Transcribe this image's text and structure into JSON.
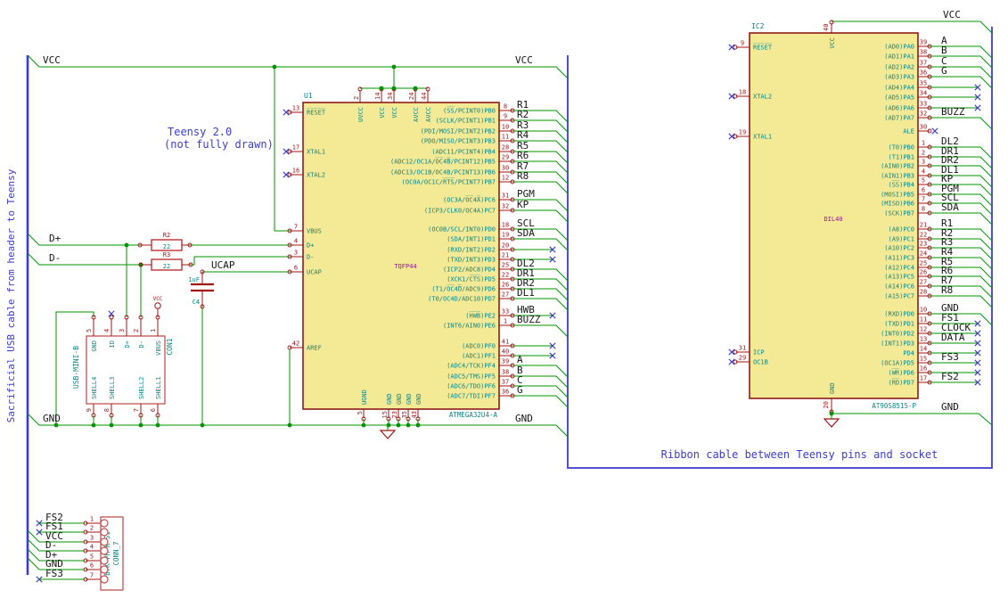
{
  "colors": {
    "wire": "#009400",
    "red": "#A01414",
    "outline": "#8E1A1A",
    "body_fill": "#F4EA96",
    "teal": "#0A8585",
    "magenta": "#8A1A8A",
    "blue": "#3C3CCC",
    "black": "#151515",
    "conn": "#C05050"
  },
  "notes": {
    "left_cable": "Sacrificial USB cable from header to Teensy",
    "teensy_line1": "Teensy 2.0",
    "teensy_line2": "(not fully drawn)",
    "ribbon": "Ribbon cable between Teensy pins and socket"
  },
  "u1": {
    "ref": "U1",
    "part": "ATMEGA32U4-A",
    "footprint": "TQFP44",
    "left_pins": [
      {
        "num": "13",
        "name": "R̅E̅S̅E̅T̅",
        "term": "nc"
      },
      {
        "num": "17",
        "name": "XTAL1",
        "term": "nc"
      },
      {
        "num": "16",
        "name": "XTAL2",
        "term": "nc"
      },
      {
        "num": "7",
        "name": "VBUS",
        "term": "wire"
      },
      {
        "num": "4",
        "name": "D+",
        "term": "wire"
      },
      {
        "num": "3",
        "name": "D-",
        "term": "wire"
      },
      {
        "num": "6",
        "name": "UCAP",
        "term": "wire"
      },
      {
        "num": "42",
        "name": "AREF",
        "term": "wire"
      }
    ],
    "top_pins": [
      {
        "num": "2",
        "name": "UVCC"
      },
      {
        "num": "14",
        "name": "VCC"
      },
      {
        "num": "34",
        "name": "VCC"
      },
      {
        "num": "24",
        "name": "AVCC"
      },
      {
        "num": "44",
        "name": "AVCC"
      }
    ],
    "bottom_pins": [
      {
        "num": "5",
        "name": "UGND"
      },
      {
        "num": "15",
        "name": "GND"
      },
      {
        "num": "23",
        "name": "GND"
      },
      {
        "num": "35",
        "name": "GND"
      },
      {
        "num": "43",
        "name": "GND"
      }
    ],
    "right_pins": [
      {
        "num": "8",
        "name": "(S̅S̅/PCINT0)PB0",
        "label": "R1",
        "term": "bus"
      },
      {
        "num": "9",
        "name": "(SCLK/PCINT1)PB1",
        "label": "R2",
        "term": "bus"
      },
      {
        "num": "10",
        "name": "(PDI/MOSI/PCINT2)PB2",
        "label": "R3",
        "term": "bus"
      },
      {
        "num": "11",
        "name": "(PDO/MISO/PCINT3)PB3",
        "label": "R4",
        "term": "bus"
      },
      {
        "num": "28",
        "name": "(ADC11/PCINT4)PB4",
        "label": "R5",
        "term": "bus"
      },
      {
        "num": "29",
        "name": "(ADC12/OC1A/O̅C̅4̅B̅/PCINT12)PB5",
        "label": "R6",
        "term": "bus"
      },
      {
        "num": "30",
        "name": "(ADC13/OC1B/OC4B/PCINT13)PB6",
        "label": "R7",
        "term": "bus"
      },
      {
        "num": "12",
        "name": "(OC0A/OC1C/R̅T̅S̅/PCINT7)PB7",
        "label": "R8",
        "term": "bus"
      },
      {
        "num": "31",
        "name": "(OC3A/O̅C̅4̅A̅)PC6",
        "label": "PGM",
        "term": "bus"
      },
      {
        "num": "32",
        "name": "(ICP3/CLK0/OC4A)PC7",
        "label": "KP",
        "term": "bus"
      },
      {
        "num": "18",
        "name": "(OC0B/SCL/INT0)PD0",
        "label": "SCL",
        "term": "bus"
      },
      {
        "num": "19",
        "name": "(SDA/INT1)PD1",
        "label": "SDA",
        "term": "bus"
      },
      {
        "num": "20",
        "name": "(RXD/INT2)PD2",
        "label": "",
        "term": "nc"
      },
      {
        "num": "21",
        "name": "(TXD/INT3)PD3",
        "label": "",
        "term": "nc"
      },
      {
        "num": "25",
        "name": "(ICP2/ADC8)PD4",
        "label": "DL2",
        "term": "bus"
      },
      {
        "num": "22",
        "name": "(XCK1/C̅T̅S̅)PD5",
        "label": "DR1",
        "term": "bus"
      },
      {
        "num": "26",
        "name": "(T1/O̅C̅4̅D̅/ADC9)PD6",
        "label": "DR2",
        "term": "bus"
      },
      {
        "num": "27",
        "name": "(T0/OC4D/ADC10)PD7",
        "label": "DL1",
        "term": "bus"
      },
      {
        "num": "33",
        "name": "(H̅W̅B̅)PE2",
        "label": "HWB",
        "term": "nc"
      },
      {
        "num": "1",
        "name": "(INT6/AIN0)PE6",
        "label": "BUZZ",
        "term": "bus"
      },
      {
        "num": "41",
        "name": "(ADC0)PF0",
        "label": "",
        "term": "nc"
      },
      {
        "num": "40",
        "name": "(ADC1)PF1",
        "label": "",
        "term": "nc"
      },
      {
        "num": "39",
        "name": "(ADC4/TCK)PF4",
        "label": "A",
        "term": "bus"
      },
      {
        "num": "38",
        "name": "(ADC5/TMS)PF5",
        "label": "B",
        "term": "bus"
      },
      {
        "num": "37",
        "name": "(ADC6/TDO)PF6",
        "label": "C",
        "term": "bus"
      },
      {
        "num": "36",
        "name": "(ADC7/TDI)PF7",
        "label": "G",
        "term": "bus"
      }
    ]
  },
  "ic2": {
    "ref": "IC2",
    "part": "AT90S8515-P",
    "footprint": "DIL40",
    "top_pin": {
      "num": "40",
      "name": "VCC"
    },
    "bottom_pin": {
      "num": "20",
      "name": "GND"
    },
    "left_pins": [
      {
        "num": "9",
        "name": "R̅E̅S̅E̅T̅",
        "term": "nc"
      },
      {
        "num": "18",
        "name": "XTAL2",
        "term": "nc"
      },
      {
        "num": "19",
        "name": "XTAL1",
        "term": "nc"
      },
      {
        "num": "31",
        "name": "ICP",
        "term": "nc"
      },
      {
        "num": "29",
        "name": "OC1B",
        "term": "nc"
      }
    ],
    "right_pins": [
      {
        "num": "39",
        "name": "(AD0)PA0",
        "label": "A",
        "term": "bus"
      },
      {
        "num": "38",
        "name": "(AD1)PA1",
        "label": "B",
        "term": "bus"
      },
      {
        "num": "37",
        "name": "(AD2)PA2",
        "label": "C",
        "term": "bus"
      },
      {
        "num": "36",
        "name": "(AD3)PA3",
        "label": "G",
        "term": "bus"
      },
      {
        "num": "35",
        "name": "(AD4)PA4",
        "label": "",
        "term": "nc"
      },
      {
        "num": "34",
        "name": "(AD5)PA5",
        "label": "",
        "term": "nc"
      },
      {
        "num": "33",
        "name": "(AD6)PA6",
        "label": "",
        "term": "nc"
      },
      {
        "num": "32",
        "name": "(AD7)PA7",
        "label": "BUZZ",
        "term": "bus"
      },
      {
        "num": "30",
        "name": "ALE",
        "label": "",
        "term": "stub"
      },
      {
        "num": "1",
        "name": "(T0)PB0",
        "label": "DL2",
        "term": "bus"
      },
      {
        "num": "2",
        "name": "(T1)PB1",
        "label": "DR1",
        "term": "bus"
      },
      {
        "num": "3",
        "name": "(AIN0)PB2",
        "label": "DR2",
        "term": "bus"
      },
      {
        "num": "4",
        "name": "(AIN1)PB3",
        "label": "DL1",
        "term": "bus"
      },
      {
        "num": "5",
        "name": "(S̅S̅)PB4",
        "label": "KP",
        "term": "bus"
      },
      {
        "num": "6",
        "name": "(MOSI)PB5",
        "label": "PGM",
        "term": "bus"
      },
      {
        "num": "7",
        "name": "(MISO)PB6",
        "label": "SCL",
        "term": "bus"
      },
      {
        "num": "8",
        "name": "(SCK)PB7",
        "label": "SDA",
        "term": "bus"
      },
      {
        "num": "21",
        "name": "(A8)PC0",
        "label": "R1",
        "term": "bus"
      },
      {
        "num": "22",
        "name": "(A9)PC1",
        "label": "R2",
        "term": "bus"
      },
      {
        "num": "23",
        "name": "(A10)PC2",
        "label": "R3",
        "term": "bus"
      },
      {
        "num": "24",
        "name": "(A11)PC3",
        "label": "R4",
        "term": "bus"
      },
      {
        "num": "25",
        "name": "(A12)PC4",
        "label": "R5",
        "term": "bus"
      },
      {
        "num": "26",
        "name": "(A13)PC5",
        "label": "R6",
        "term": "bus"
      },
      {
        "num": "27",
        "name": "(A14)PC6",
        "label": "R7",
        "term": "bus"
      },
      {
        "num": "28",
        "name": "(A15)PC7",
        "label": "R8",
        "term": "bus"
      },
      {
        "num": "10",
        "name": "(RXD)PD0",
        "label": "GND",
        "term": "bus"
      },
      {
        "num": "11",
        "name": "(TXD)PD1",
        "label": "FS1",
        "term": "nc"
      },
      {
        "num": "12",
        "name": "(INT0)PD2",
        "label": "CLOCK",
        "term": "nc"
      },
      {
        "num": "13",
        "name": "(INT1)PD3",
        "label": "DATA",
        "term": "nc"
      },
      {
        "num": "14",
        "name": "PD4",
        "label": "",
        "term": "nc"
      },
      {
        "num": "15",
        "name": "(OC1A)PD5",
        "label": "FS3",
        "term": "nc"
      },
      {
        "num": "16",
        "name": "(W̅R̅)PD6",
        "label": "",
        "term": "nc"
      },
      {
        "num": "17",
        "name": "(R̅D̅)PD7",
        "label": "FS2",
        "term": "nc"
      }
    ]
  },
  "con1": {
    "ref": "CON1",
    "part": "USB-MINI-B",
    "top_pins": [
      {
        "num": "5",
        "name": "GND",
        "term": "wire"
      },
      {
        "num": "4",
        "name": "ID",
        "term": "nc"
      },
      {
        "num": "3",
        "name": "D+",
        "term": "wire"
      },
      {
        "num": "2",
        "name": "D-",
        "term": "wire"
      },
      {
        "num": "1",
        "name": "VBUS",
        "term": "vcc"
      }
    ],
    "bottom_pins": [
      {
        "num": "9",
        "name": "SHELL4"
      },
      {
        "num": "8",
        "name": "SHELL3"
      },
      {
        "num": "7",
        "name": "SHELL2"
      },
      {
        "num": "6",
        "name": "SHELL1"
      }
    ]
  },
  "conn7": {
    "ref": "CONN_7",
    "part": "B7K-PH-K-S1",
    "pins": [
      {
        "num": "1",
        "label": "FS2",
        "term": "nc"
      },
      {
        "num": "2",
        "label": "FS1",
        "term": "nc"
      },
      {
        "num": "3",
        "label": "VCC",
        "term": "bus"
      },
      {
        "num": "4",
        "label": "D-",
        "term": "bus"
      },
      {
        "num": "5",
        "label": "D+",
        "term": "bus"
      },
      {
        "num": "6",
        "label": "GND",
        "term": "bus"
      },
      {
        "num": "7",
        "label": "FS3",
        "term": "nc"
      }
    ]
  },
  "r2": {
    "ref": "R2",
    "value": "22"
  },
  "r3": {
    "ref": "R3",
    "value": "22"
  },
  "c4": {
    "ref": "C4",
    "value": "1uF"
  },
  "power_flag": {
    "label": "VCC"
  },
  "net_labels": [
    {
      "text": "VCC"
    },
    {
      "text": "VCC"
    },
    {
      "text": "GND"
    },
    {
      "text": "GND"
    },
    {
      "text": "D+"
    },
    {
      "text": "D-"
    },
    {
      "text": "UCAP"
    },
    {
      "text": "VCC"
    },
    {
      "text": "GND"
    }
  ]
}
